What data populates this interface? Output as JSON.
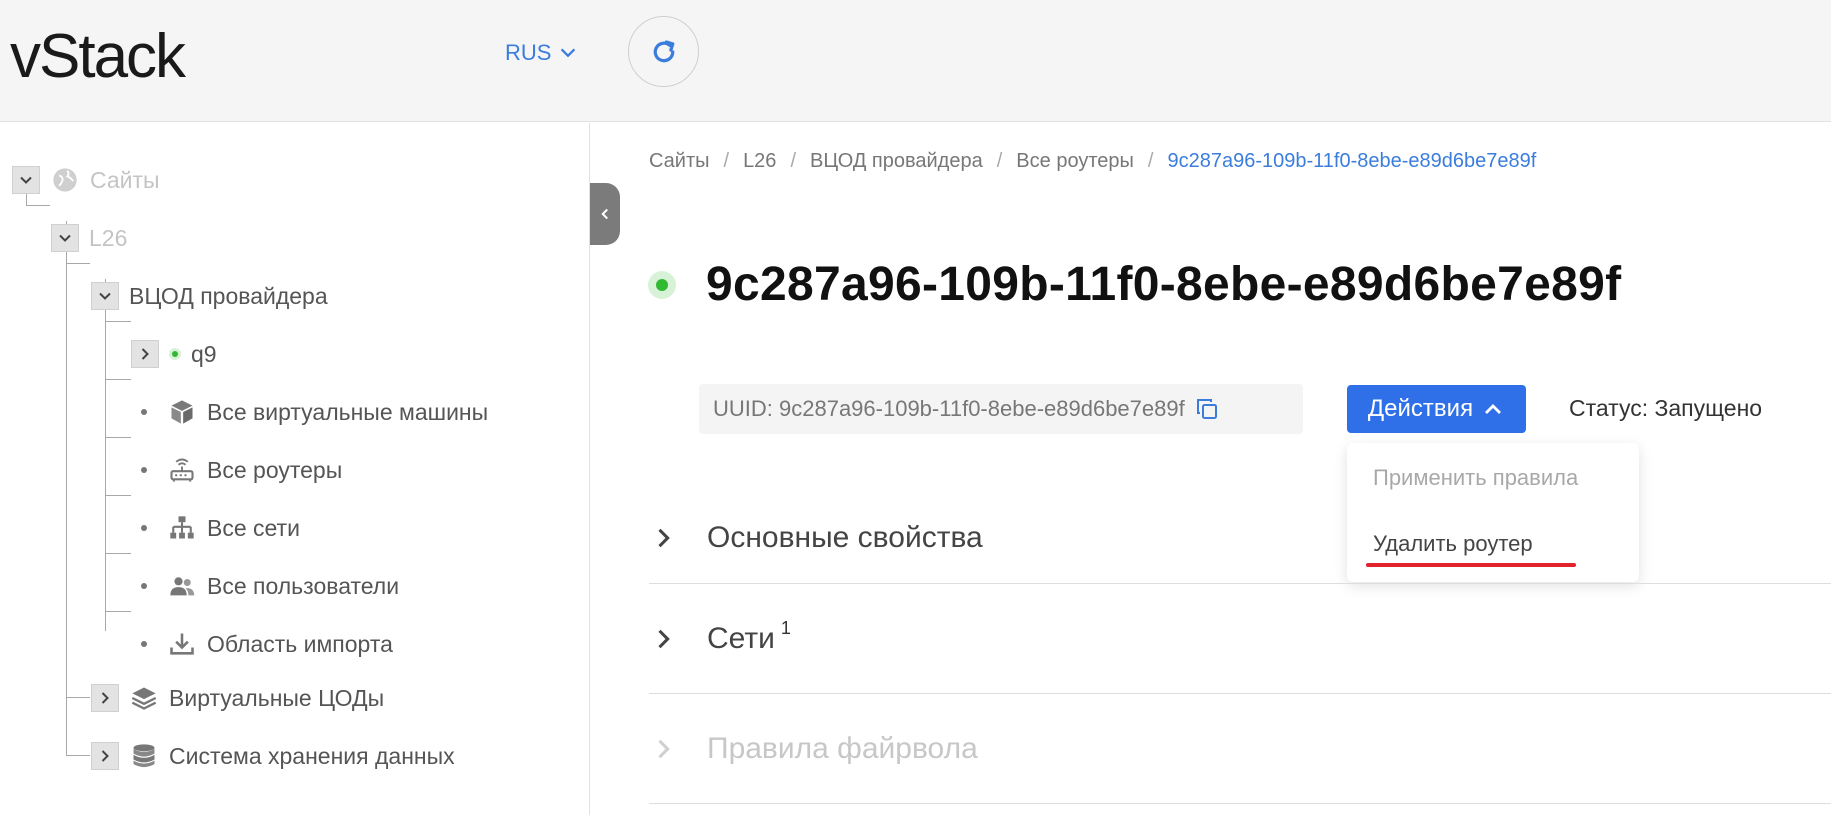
{
  "header": {
    "logo": "vStack",
    "language": "RUS"
  },
  "sidebar": {
    "tree": {
      "sites": "Сайты",
      "l26": "L26",
      "vcod_provider": "ВЦОД провайдера",
      "q9": "q9",
      "all_vms": "Все виртуальные машины",
      "all_routers": "Все роутеры",
      "all_networks": "Все сети",
      "all_users": "Все пользователи",
      "import_area": "Область импорта",
      "virtual_dcs": "Виртуальные ЦОДы",
      "storage": "Система хранения данных"
    }
  },
  "breadcrumb": {
    "items": [
      "Сайты",
      "L26",
      "ВЦОД провайдера",
      "Все роутеры"
    ],
    "separator": "/",
    "current": "9c287a96-109b-11f0-8ebe-e89d6be7e89f"
  },
  "main": {
    "title": "9c287a96-109b-11f0-8ebe-e89d6be7e89f",
    "uuid_label": "UUID: 9c287a96-109b-11f0-8ebe-e89d6be7e89f",
    "actions_label": "Действия",
    "status_label": "Статус: Запущено",
    "dropdown": {
      "apply_rules": "Применить правила",
      "delete_router": "Удалить роутер"
    },
    "sections": {
      "basic_props": "Основные свойства",
      "networks": "Сети",
      "networks_count": "1",
      "firewall_rules": "Правила файрвола"
    }
  },
  "colors": {
    "accent": "#2f6fe7",
    "link": "#3b7ddd",
    "status_green": "#32b932",
    "highlight_red": "#e2232b"
  }
}
